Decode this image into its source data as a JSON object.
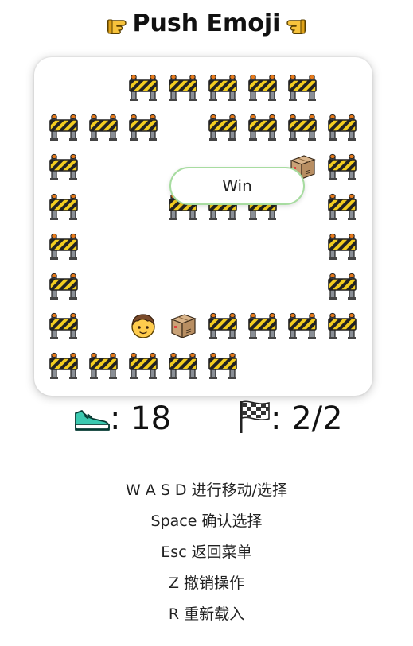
{
  "title": "Push Emoji",
  "board": {
    "cols": 8,
    "rows": 8,
    "legend": {
      "B": "barrier",
      "P": "player",
      "X": "box"
    },
    "grid": [
      "  BBBBB ",
      "BBB BBBB",
      "B     XB",
      "B  BBB B",
      "B      B",
      "B      B",
      "B PXBBBB",
      "BBBBB   "
    ]
  },
  "win_button": {
    "label": "Win"
  },
  "stats": {
    "steps_icon": "sneaker-icon",
    "steps": ": 18",
    "goal_icon": "checkered-flag-icon",
    "goals": ": 2/2"
  },
  "help": [
    "W A S D 进行移动/选择",
    "Space 确认选择",
    "Esc 返回菜单",
    "Z 撤销操作",
    "R 重新载入"
  ]
}
